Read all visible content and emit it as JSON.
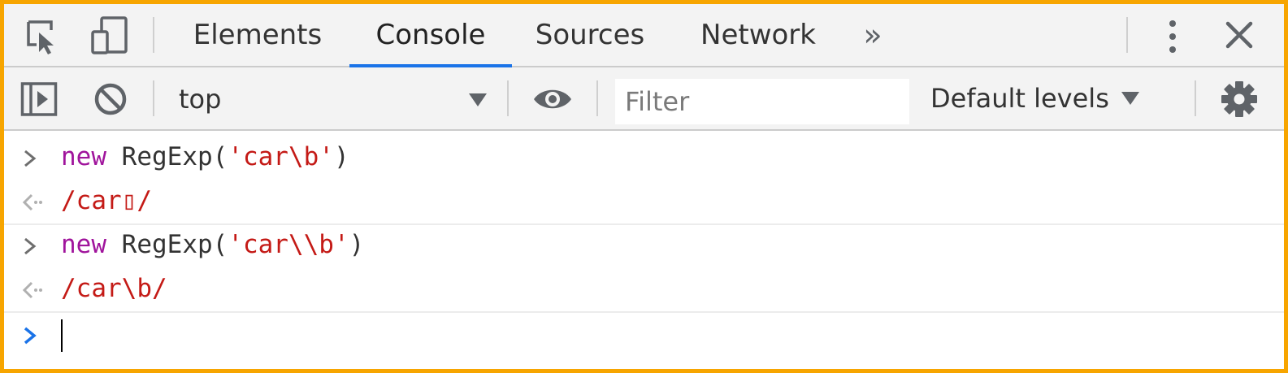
{
  "tabbar": {
    "tabs": [
      {
        "label": "Elements"
      },
      {
        "label": "Console"
      },
      {
        "label": "Sources"
      },
      {
        "label": "Network"
      }
    ],
    "more_tabs_glyph": "»",
    "active_tab": "Console",
    "icons": [
      "inspect-icon",
      "device-toggle-icon",
      "more-vert-icon",
      "close-icon"
    ]
  },
  "toolbar": {
    "context": "top",
    "filter_placeholder": "Filter",
    "levels_label": "Default levels",
    "icons": [
      "sidebar-toggle-icon",
      "clear-console-icon",
      "dropdown-arrow-icon",
      "eye-icon",
      "settings-icon"
    ]
  },
  "console": {
    "entries": [
      {
        "kind": "input",
        "keyword": "new",
        "callee": " RegExp(",
        "string": "'car\\b'",
        "close": ")"
      },
      {
        "kind": "output",
        "value": "/car▯/"
      },
      {
        "kind": "input",
        "keyword": "new",
        "callee": " RegExp(",
        "string": "'car\\\\b'",
        "close": ")"
      },
      {
        "kind": "output",
        "value": "/car\\b/"
      }
    ]
  },
  "colors": {
    "frame": "#f7a500",
    "accent": "#1a73e8",
    "keyword": "#a0149c",
    "string": "#c41a16",
    "prompt_active": "#1a73e8"
  }
}
